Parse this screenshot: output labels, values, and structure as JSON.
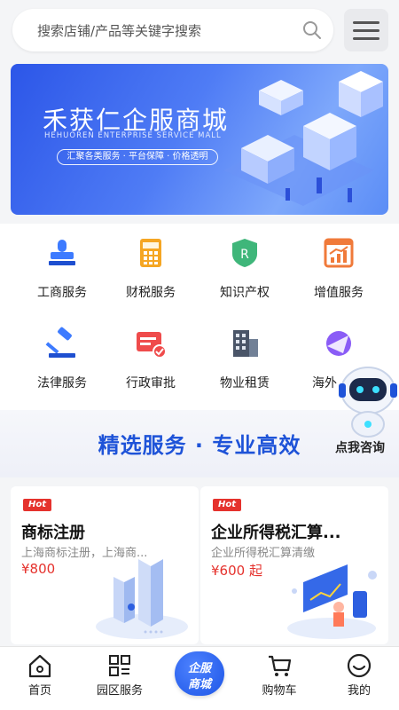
{
  "search": {
    "placeholder": "搜索店铺/产品等关键字搜索"
  },
  "banner": {
    "title": "禾获仁企服商城",
    "subtitle": "HEHUOREN ENTERPRISE SERVICE MALL",
    "tagline": "汇聚各类服务 · 平台保障 · 价格透明"
  },
  "services": [
    {
      "label": "工商服务",
      "icon": "stamp-icon"
    },
    {
      "label": "财税服务",
      "icon": "calculator-icon"
    },
    {
      "label": "知识产权",
      "icon": "trademark-shield-icon"
    },
    {
      "label": "增值服务",
      "icon": "chart-icon"
    },
    {
      "label": "法律服务",
      "icon": "gavel-icon"
    },
    {
      "label": "行政审批",
      "icon": "approval-card-icon"
    },
    {
      "label": "物业租赁",
      "icon": "building-icon"
    },
    {
      "label": "海外",
      "icon": "globe-plane-icon"
    }
  ],
  "section_banner": {
    "title": "精选服务 · 专业高效"
  },
  "assistant": {
    "label": "点我咨询"
  },
  "products": [
    {
      "badge": "Hot",
      "title": "商标注册",
      "desc": "上海商标注册，上海商...",
      "price": "¥800"
    },
    {
      "badge": "Hot",
      "title": "企业所得税汇算...",
      "desc": "企业所得税汇算清缴",
      "price": "¥600 起"
    }
  ],
  "tabs": [
    {
      "label": "首页",
      "icon": "home-icon"
    },
    {
      "label": "园区服务",
      "icon": "grid-icon"
    },
    {
      "label": "购物车",
      "icon": "cart-icon"
    },
    {
      "label": "我的",
      "icon": "smile-icon"
    }
  ],
  "center_tab": {
    "line1": "企服",
    "line2": "商城"
  },
  "colors": {
    "accent": "#1e53d8",
    "price": "#e5322d",
    "hot": "#e5322d"
  }
}
